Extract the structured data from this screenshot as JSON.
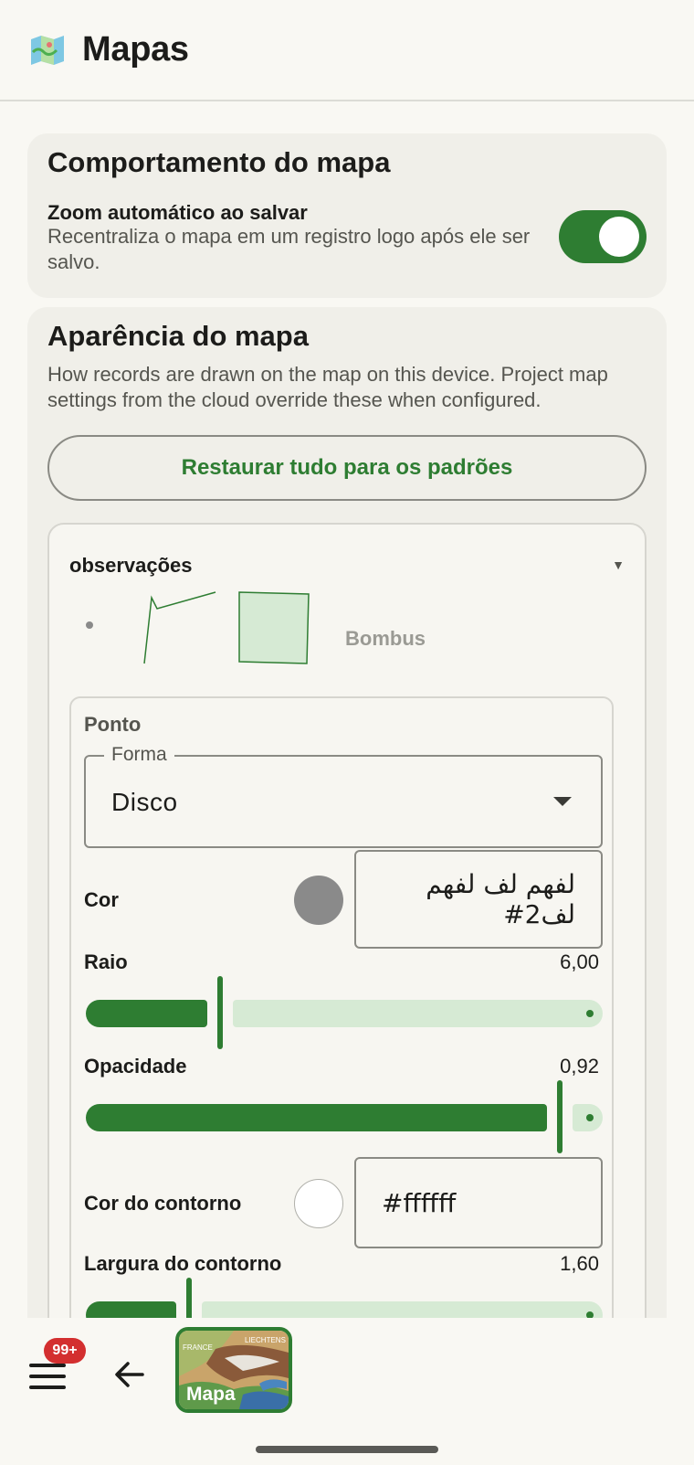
{
  "app": {
    "title": "Mapas",
    "icon": "map-icon"
  },
  "behavior": {
    "title": "Comportamento do mapa",
    "zoom_title": "Zoom automático ao salvar",
    "zoom_desc": "Recentraliza o mapa em um registro logo após ele ser salvo.",
    "zoom_enabled": true
  },
  "appearance": {
    "title": "Aparência do mapa",
    "desc": "How records are drawn on the map on this device. Project map settings from the cloud override these when configured.",
    "restore_label": "Restaurar tudo para os padrões",
    "layer": {
      "name": "observações",
      "preview_label": "Bombus",
      "point": {
        "title": "Ponto",
        "shape_label": "Forma",
        "shape_value": "Disco",
        "color_label": "Cor",
        "color_value": "لفهم لف لفهم لف2#",
        "color_swatch": "#8a8a8a",
        "radius_label": "Raio",
        "radius_value": "6,00",
        "radius_fraction": 0.26,
        "opacity_label": "Opacidade",
        "opacity_value": "0,92",
        "opacity_fraction": 0.92,
        "stroke_color_label": "Cor do contorno",
        "stroke_color_value": "#ffffff",
        "stroke_swatch": "#ffffff",
        "stroke_width_label": "Largura do contorno",
        "stroke_width_value": "1,60",
        "stroke_width_fraction": 0.2
      }
    }
  },
  "bottom": {
    "badge": "99+",
    "map_label": "Mapa",
    "map_countries": [
      "FRANCE",
      "LIECHTENS"
    ]
  },
  "colors": {
    "accent": "#2e7d32",
    "accent_light": "#d6ead4",
    "badge": "#d32f2f"
  }
}
